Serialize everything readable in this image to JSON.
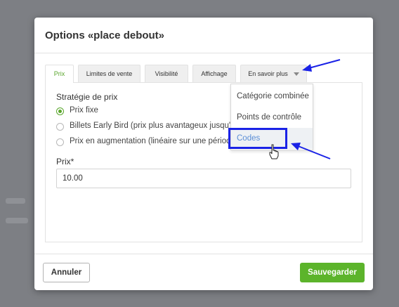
{
  "dialog": {
    "title": "Options «place debout»"
  },
  "tabs": [
    {
      "label": "Prix",
      "active": true
    },
    {
      "label": "Limites de vente",
      "active": false
    },
    {
      "label": "Visibilité",
      "active": false
    },
    {
      "label": "Affichage",
      "active": false
    },
    {
      "label": "En savoir plus",
      "active": false
    }
  ],
  "pricing": {
    "section_title": "Stratégie de prix",
    "options": [
      {
        "label": "Prix fixe",
        "checked": true
      },
      {
        "label": "Billets Early Bird (prix plus avantageux jusqu'à",
        "checked": false
      },
      {
        "label": "Prix en augmentation (linéaire sur une périod",
        "checked": false
      }
    ],
    "price_label": "Prix*",
    "price_value": "10.00"
  },
  "dropdown": {
    "items": [
      {
        "label": "Catégorie combinée",
        "highlighted": false
      },
      {
        "label": "Points de contrôle",
        "highlighted": false
      },
      {
        "label": "Codes",
        "highlighted": true
      }
    ]
  },
  "footer": {
    "cancel_label": "Annuler",
    "save_label": "Sauvegarder"
  },
  "colors": {
    "accent_green": "#5cb42b",
    "annotation_blue": "#1a22e6",
    "link_blue": "#5b8ed6"
  }
}
